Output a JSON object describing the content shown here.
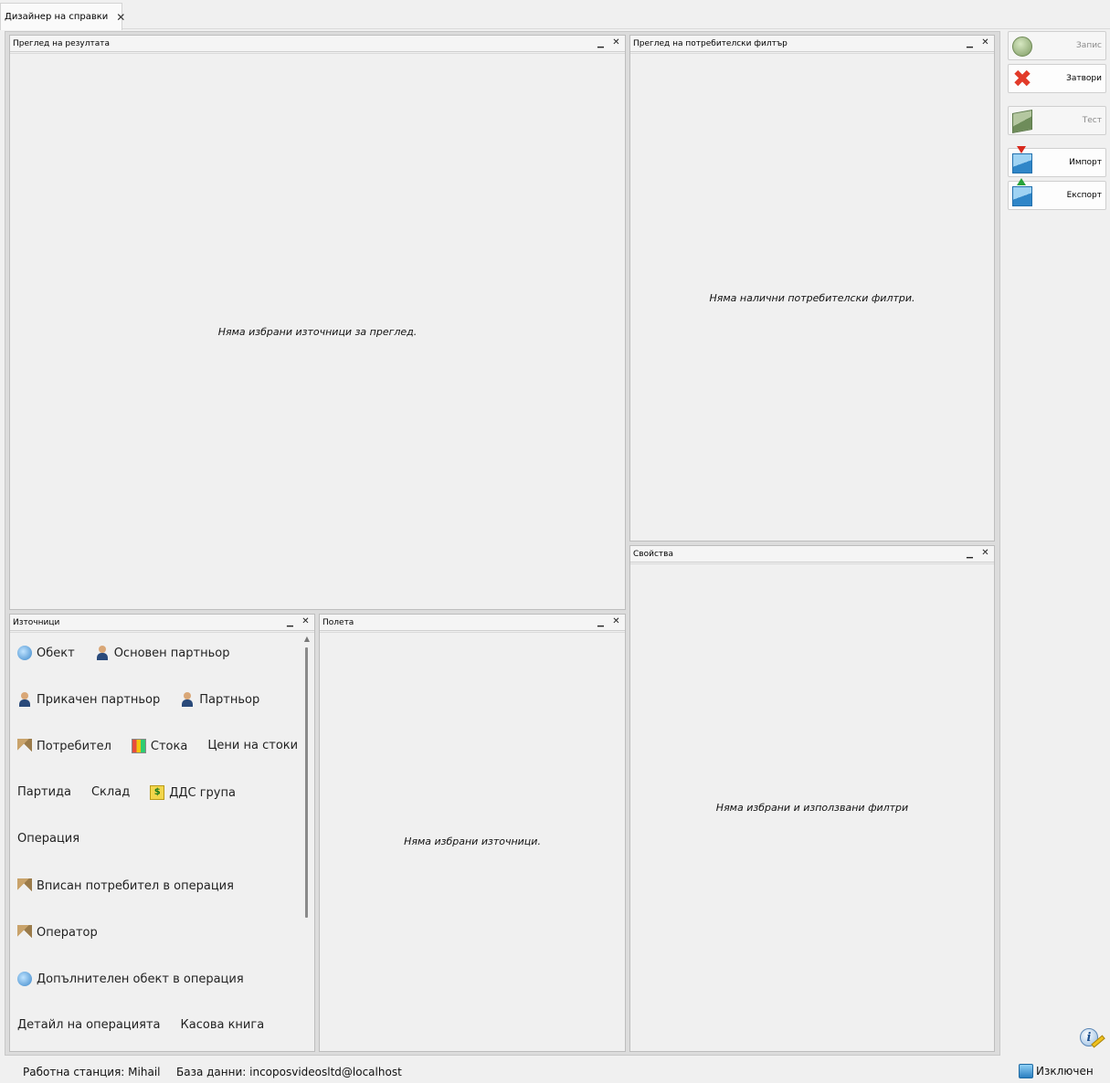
{
  "tab": {
    "label": "Дизайнер на справки"
  },
  "panels": {
    "result_preview": {
      "title": "Преглед на резултата",
      "empty_message": "Няма избрани източници за преглед."
    },
    "user_filter_preview": {
      "title": "Преглед на потребителски филтър",
      "empty_message": "Няма налични потребителски филтри."
    },
    "properties": {
      "title": "Свойства",
      "empty_message": "Няма избрани и използвани филтри"
    },
    "sources": {
      "title": "Източници"
    },
    "fields": {
      "title": "Полета",
      "empty_message": "Няма избрани източници."
    }
  },
  "sources": {
    "rows": [
      [
        {
          "label": "Обект",
          "icon": "globe-icon"
        },
        {
          "label": "Основен партньор",
          "icon": "person-icon"
        }
      ],
      [
        {
          "label": "Прикачен партньор",
          "icon": "person-icon"
        },
        {
          "label": "Партньор",
          "icon": "person-icon"
        }
      ],
      [
        {
          "label": "Потребител",
          "icon": "keys-icon"
        },
        {
          "label": "Стока",
          "icon": "goods-icon"
        },
        {
          "label": "Цени на стоки",
          "icon": ""
        }
      ],
      [
        {
          "label": "Партида",
          "icon": ""
        },
        {
          "label": "Склад",
          "icon": ""
        },
        {
          "label": "ДДС група",
          "icon": "money-icon"
        }
      ],
      [
        {
          "label": "Операция",
          "icon": ""
        }
      ],
      [
        {
          "label": "Вписан потребител в операция",
          "icon": "keys-icon"
        }
      ],
      [
        {
          "label": "Оператор",
          "icon": "keys-icon"
        }
      ],
      [
        {
          "label": "Допълнителен обект в операция",
          "icon": "globe-icon"
        }
      ],
      [
        {
          "label": "Детайл на операцията",
          "icon": ""
        },
        {
          "label": "Касова книга",
          "icon": ""
        }
      ]
    ]
  },
  "toolbar": {
    "save": "Запис",
    "close": "Затвори",
    "test": "Тест",
    "import": "Импорт",
    "export": "Експорт"
  },
  "status": {
    "workstation": "Работна станция: Mihail",
    "database": "База данни: incoposvideosltd@localhost",
    "logout": "Изключен"
  }
}
